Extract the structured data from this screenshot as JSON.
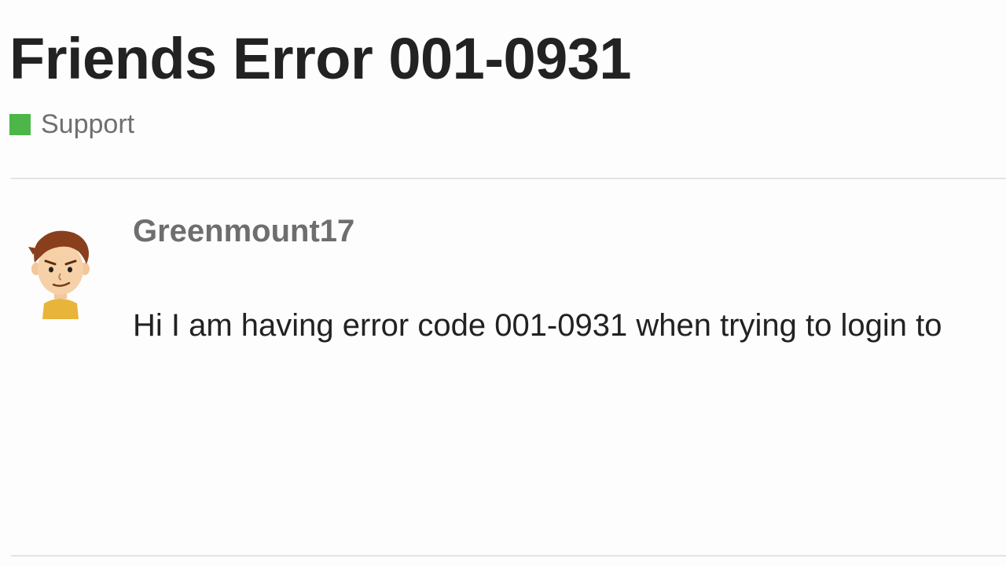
{
  "post": {
    "title": "Friends Error 001-0931",
    "category": {
      "label": "Support",
      "color": "#4cb748"
    },
    "author": {
      "name": "Greenmount17",
      "avatar_icon": "mii-avatar-icon"
    },
    "body": "Hi I am having error code 001-0931 when trying to login to"
  }
}
